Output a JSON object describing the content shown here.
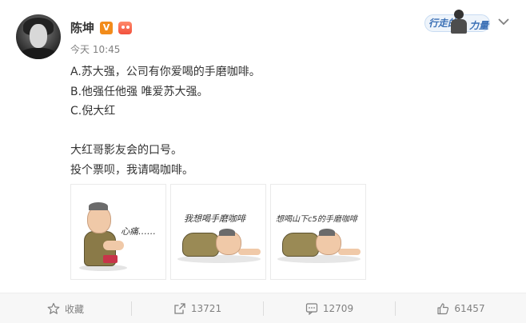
{
  "post": {
    "author": "陈坤",
    "time": "今天 10:45",
    "promo_text_left": "行走的",
    "promo_text_right": "力量",
    "lines": [
      "A.苏大强，公司有你爱喝的手磨咖啡。",
      "B.他强任他强 唯爱苏大强。",
      "C.倪大红",
      "",
      "大红哥影友会的口号。",
      "投个票呗，我请喝咖啡。"
    ],
    "images": [
      {
        "caption": "心痛……"
      },
      {
        "caption": "我想喝手磨咖啡"
      },
      {
        "caption": "想喝山下c5的手磨咖啡"
      }
    ]
  },
  "actions": {
    "favorite": "收藏",
    "repost": "13721",
    "comment": "12709",
    "like": "61457"
  },
  "colors": {
    "verify_badge": "#f28c1b",
    "text": "#333333",
    "meta": "#808080",
    "action_bar": "#f7f7f7"
  },
  "icons": [
    "verified-v-icon",
    "member-crown-icon",
    "chevron-down-icon",
    "star-icon",
    "share-icon",
    "comment-icon",
    "thumbs-up-icon"
  ]
}
